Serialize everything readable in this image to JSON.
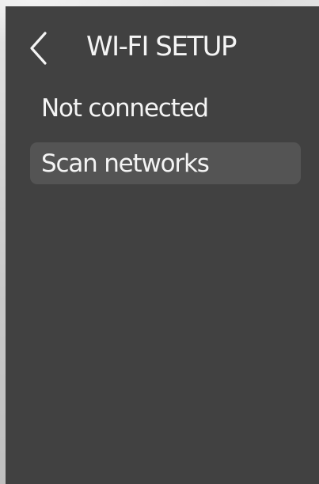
{
  "header": {
    "back_icon": "chevron-left-icon",
    "title": "WI-FI SETUP"
  },
  "wifi": {
    "status": "Not connected",
    "scan_label": "Scan networks"
  },
  "colors": {
    "screen_bg": "#414141",
    "button_bg": "#545454",
    "text": "#f4f4f4"
  }
}
